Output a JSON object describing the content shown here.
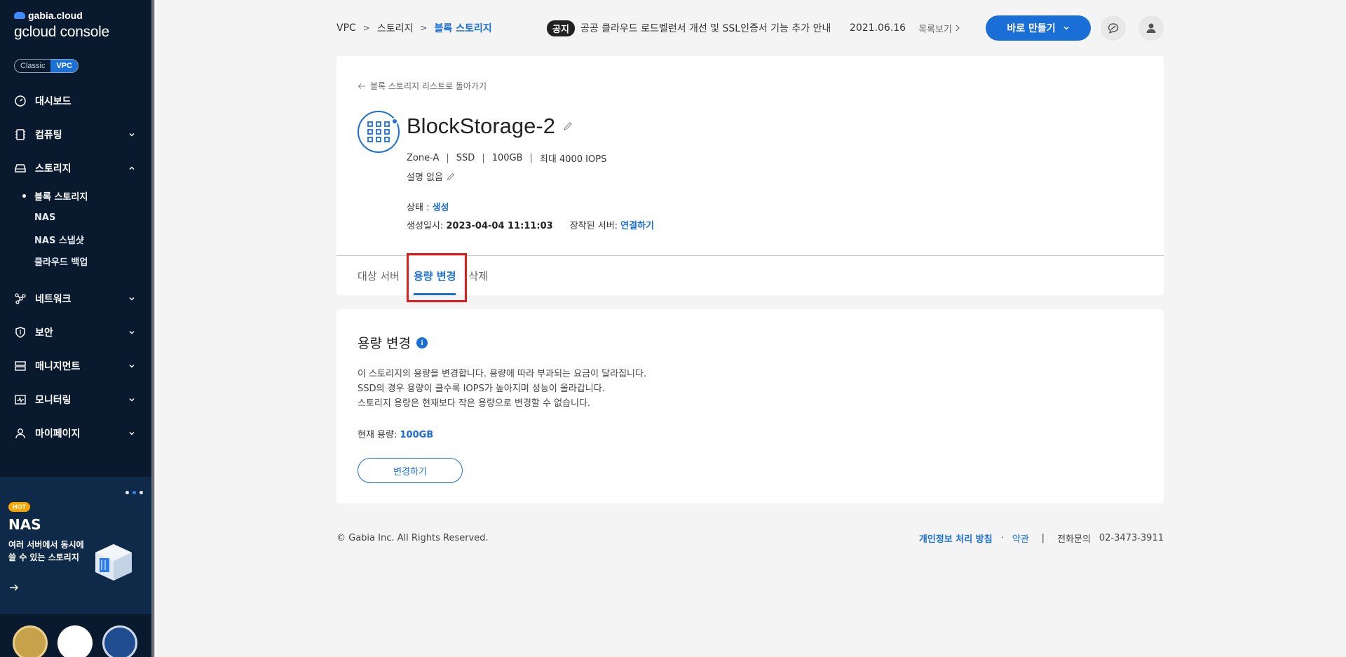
{
  "sidebar": {
    "brand_top": "gabia.cloud",
    "brand_bottom": "gcloud console",
    "mode_classic": "Classic",
    "mode_vpc": "VPC",
    "items": [
      {
        "label": "대시보드"
      },
      {
        "label": "컴퓨팅"
      },
      {
        "label": "스토리지"
      },
      {
        "label": "네트워크"
      },
      {
        "label": "보안"
      },
      {
        "label": "매니지먼트"
      },
      {
        "label": "모니터링"
      },
      {
        "label": "마이페이지"
      }
    ],
    "storage_sub": [
      "블록 스토리지",
      "NAS",
      "NAS 스냅샷",
      "클라우드 백업"
    ],
    "promo": {
      "badge": "HOT",
      "title": "NAS",
      "desc": "여러 서버에서 동시에 쓸 수 있는 스토리지"
    }
  },
  "header": {
    "breadcrumb": [
      "VPC",
      "스토리지",
      "블록 스토리지"
    ],
    "notice_badge": "공지",
    "notice_text": "공공 클라우드 로드벨런서 개선 및 SSL인증서 기능 추가 안내",
    "notice_date": "2021.06.16",
    "notice_more": "목록보기",
    "create_button": "바로 만들기"
  },
  "detail": {
    "back_link": "블록 스토리지 리스트로 돌아가기",
    "name": "BlockStorage-2",
    "specs": [
      "Zone-A",
      "SSD",
      "100GB",
      "최대 4000 IOPS"
    ],
    "description": "설명 없음",
    "status_label": "상태 : ",
    "status_value": "생성",
    "created_label": "생성일시: ",
    "created_value": "2023-04-04 11:11:03",
    "server_label": "장착된 서버: ",
    "server_value": "연결하기",
    "tabs": [
      "대상 서버",
      "용량 변경",
      "삭제"
    ]
  },
  "capacity": {
    "title": "용량 변경",
    "info_icon": "i",
    "lines": [
      "이 스토리지의 용량을 변경합니다. 용량에 따라 부과되는 요금이 달라집니다.",
      "SSD의 경우 용량이 클수록 IOPS가 높아지며 성능이 올라갑니다.",
      "스토리지 용량은 현재보다 작은 용량으로 변경할 수 없습니다."
    ],
    "current_label": "현재 용량: ",
    "current_value": "100GB",
    "change_button": "변경하기"
  },
  "footer": {
    "copyright": "© Gabia Inc. All Rights Reserved.",
    "privacy": "개인정보 처리 방침",
    "dot": "·",
    "terms": "약관",
    "bar": "|",
    "phone_label": "전화문의",
    "phone": "02-3473-3911"
  },
  "colors": {
    "accent": "#1a6fd6",
    "sidebar_bg": "#0a1a2e",
    "highlight": "#e21b1b"
  }
}
